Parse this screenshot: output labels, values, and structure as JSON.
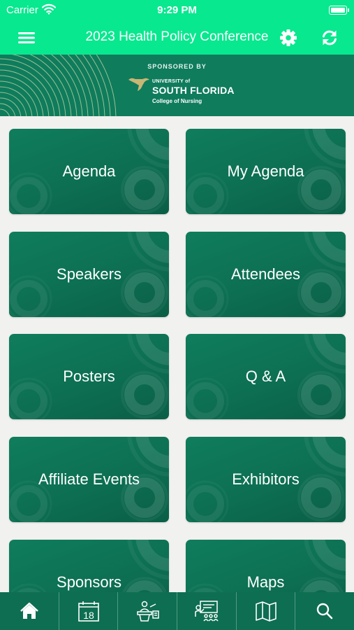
{
  "status_bar": {
    "carrier": "Carrier",
    "time": "9:29 PM"
  },
  "nav": {
    "title": "2023 Health Policy Conference"
  },
  "banner": {
    "sponsored_by": "SPONSORED BY",
    "university_small": "UNIVERSITY of",
    "university_big": "SOUTH FLORIDA",
    "college": "College of Nursing"
  },
  "tiles": [
    {
      "label": "Agenda"
    },
    {
      "label": "My Agenda"
    },
    {
      "label": "Speakers"
    },
    {
      "label": "Attendees"
    },
    {
      "label": "Posters"
    },
    {
      "label": "Q & A"
    },
    {
      "label": "Affiliate Events"
    },
    {
      "label": "Exhibitors"
    },
    {
      "label": "Sponsors"
    },
    {
      "label": "Maps"
    }
  ],
  "tab_bar": {
    "items": [
      {
        "icon": "home-icon"
      },
      {
        "icon": "calendar-icon",
        "day": "18"
      },
      {
        "icon": "speaker-podium-icon"
      },
      {
        "icon": "presentation-icon"
      },
      {
        "icon": "map-icon"
      },
      {
        "icon": "search-icon"
      }
    ]
  },
  "colors": {
    "header": "#08e88f",
    "tile": "#0f7c5c",
    "tab_bar": "#0e6e51",
    "background": "#f1f1ef"
  }
}
